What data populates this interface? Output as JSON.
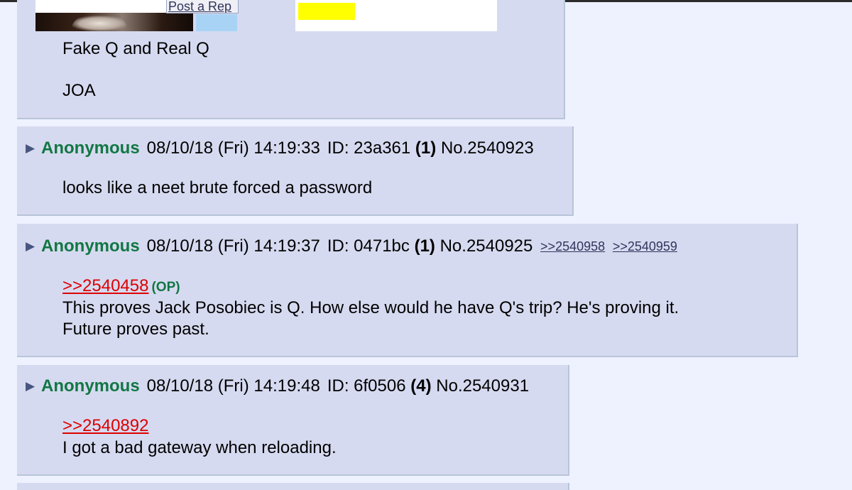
{
  "top_post": {
    "image_link_text": "Post a Rep",
    "lines": [
      "Fake Q and Real Q",
      "JOA"
    ]
  },
  "posts": [
    {
      "arrow": "▶",
      "name": "Anonymous",
      "date": "08/10/18 (Fri) 14:19:33",
      "id": "ID: 23a361",
      "count": "(1)",
      "number": "No.2540923",
      "body": [
        "looks like a neet brute forced a password"
      ]
    },
    {
      "arrow": "▶",
      "name": "Anonymous",
      "date": "08/10/18 (Fri) 14:19:37",
      "id": "ID: 0471bc",
      "count": "(1)",
      "number": "No.2540925",
      "backlinks": [
        ">>2540958",
        ">>2540959"
      ],
      "quote": ">>2540458",
      "quote_tag": "(OP)",
      "body": [
        "This proves Jack Posobiec is Q. How else would he have Q's trip? He's proving it.",
        "Future proves past."
      ]
    },
    {
      "arrow": "▶",
      "name": "Anonymous",
      "date": "08/10/18 (Fri) 14:19:48",
      "id": "ID: 6f0506",
      "count": "(4)",
      "number": "No.2540931",
      "quote": ">>2540892",
      "body": [
        "I got a bad gateway when reloading."
      ]
    }
  ],
  "colors": {
    "page_background": "#eef2ff",
    "post_background": "#d6daf0",
    "name": "#117743",
    "quote_link": "#dd0000",
    "backlink": "#34345c"
  }
}
